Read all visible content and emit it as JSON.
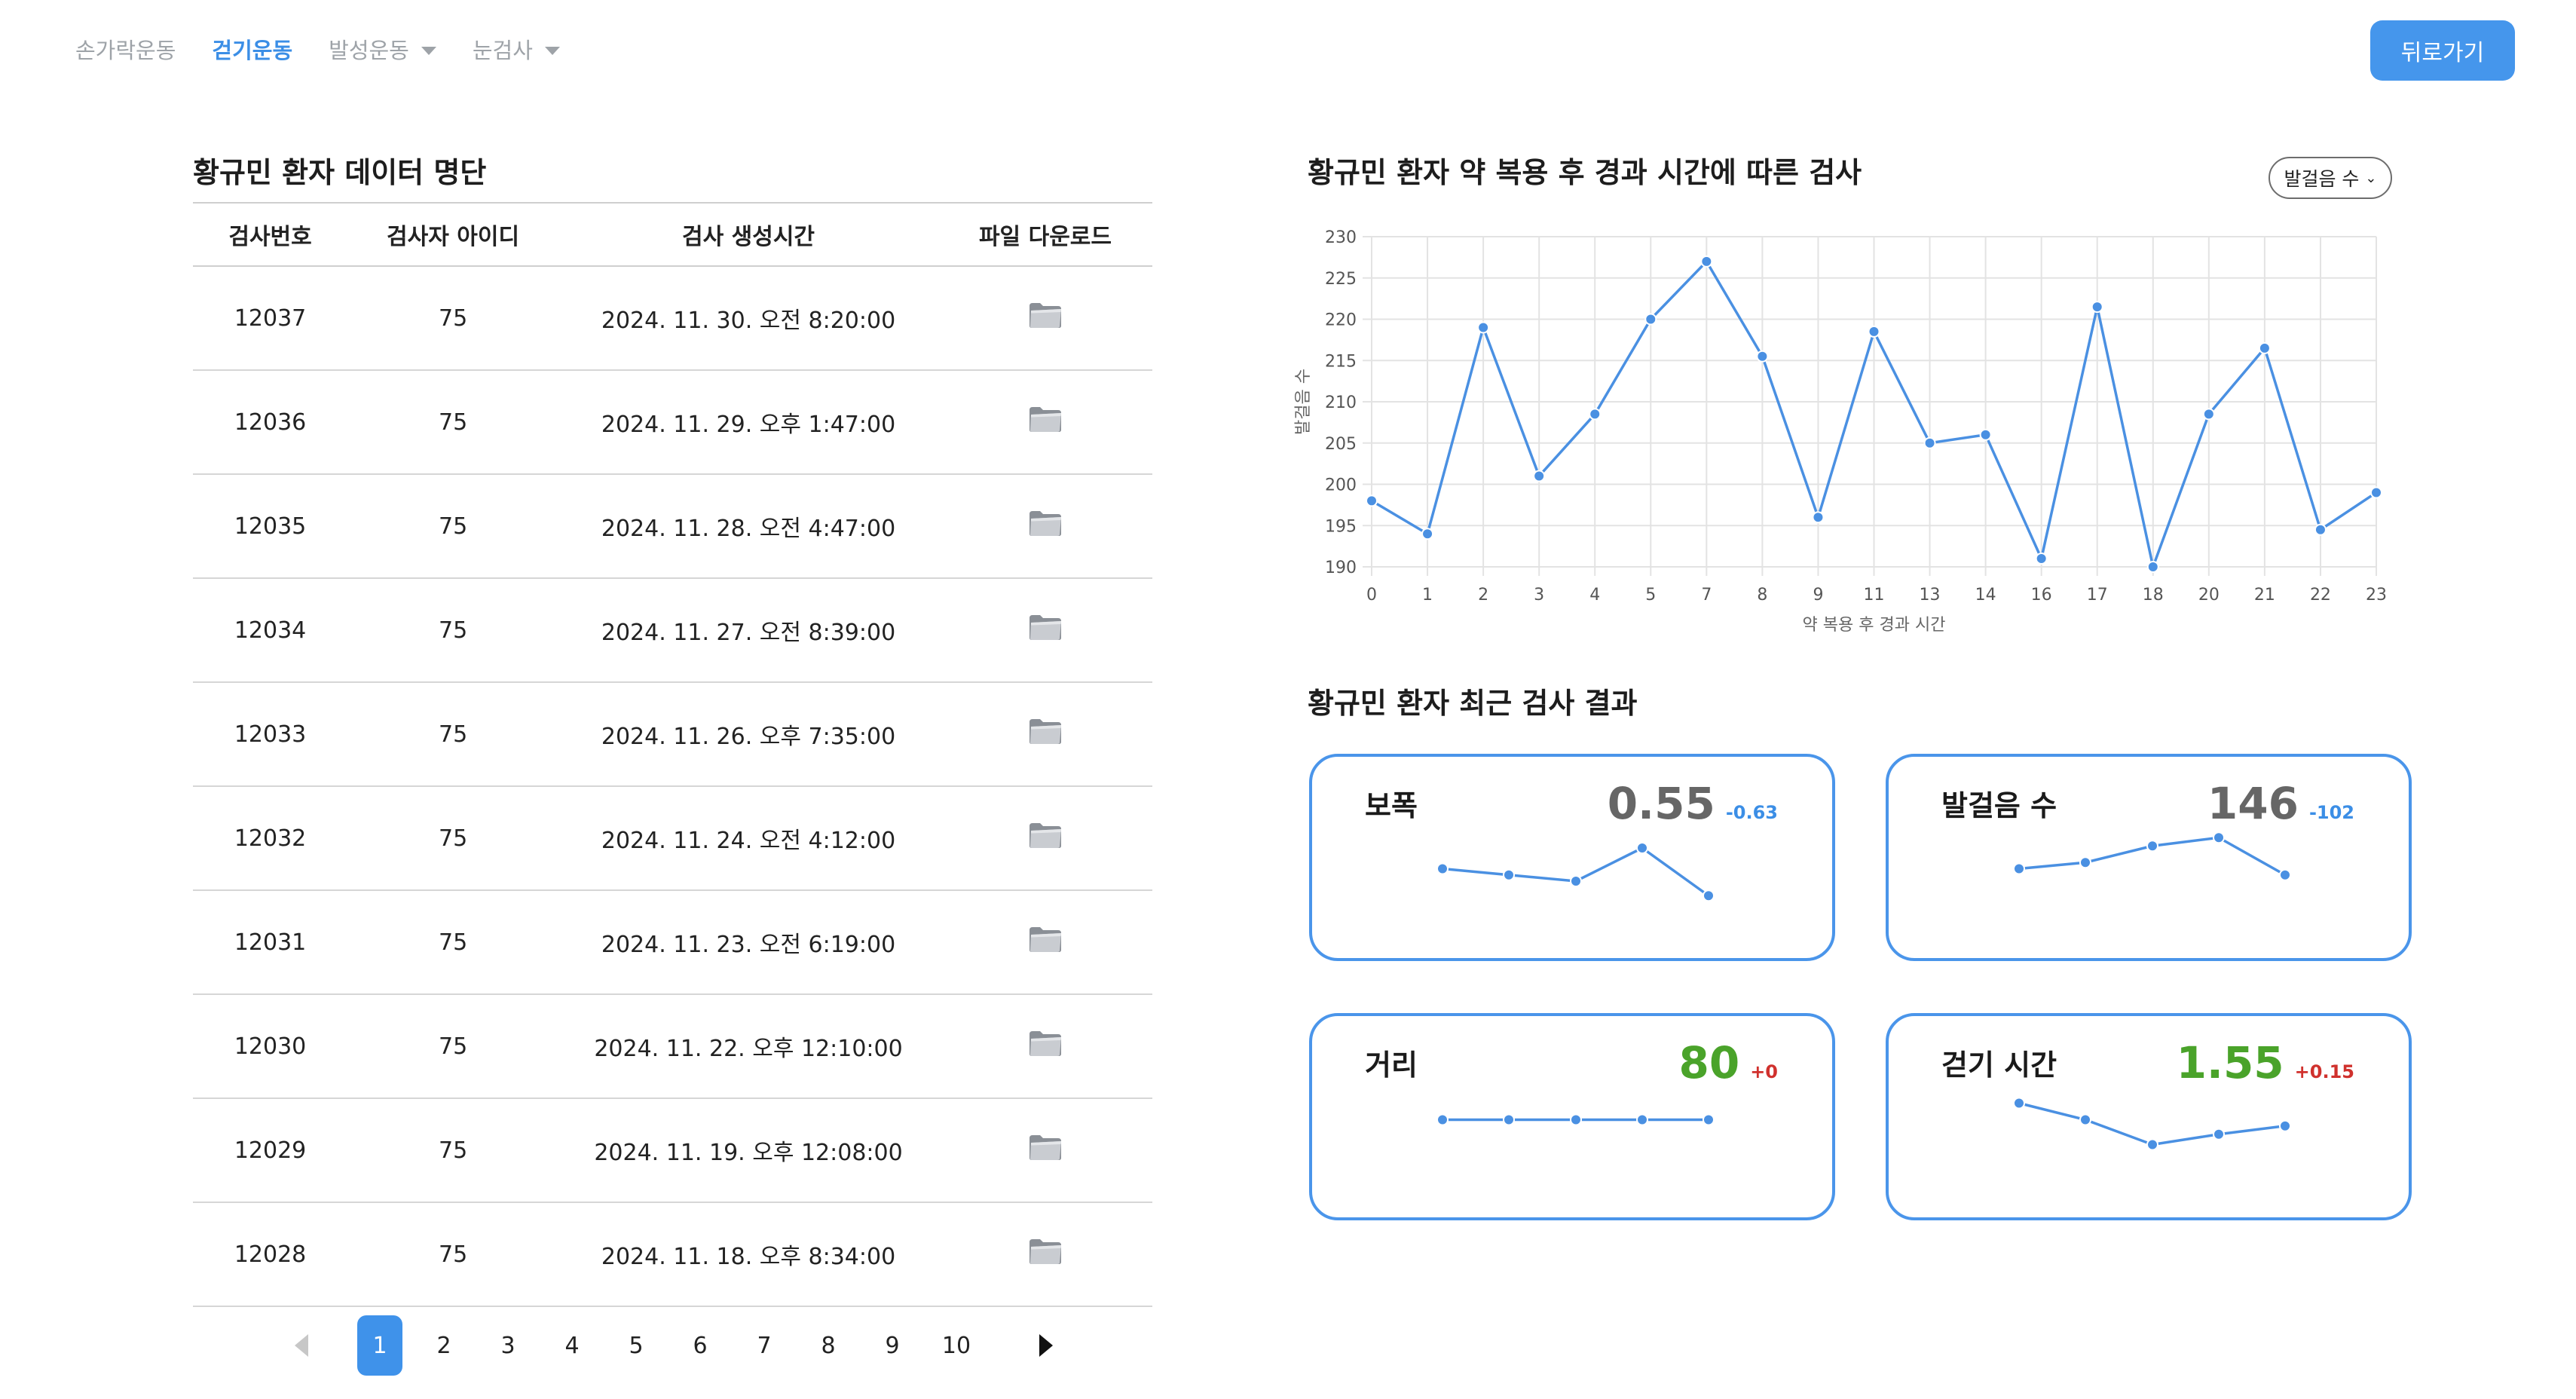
{
  "nav": {
    "items": [
      {
        "label": "손가락운동",
        "active": false,
        "dropdown": false
      },
      {
        "label": "걷기운동",
        "active": true,
        "dropdown": false
      },
      {
        "label": "발성운동",
        "active": false,
        "dropdown": true
      },
      {
        "label": "눈검사",
        "active": false,
        "dropdown": true
      }
    ],
    "back_label": "뒤로가기"
  },
  "table_section": {
    "title": "황규민 환자 데이터 명단",
    "headers": [
      "검사번호",
      "검사자 아이디",
      "검사 생성시간",
      "파일 다운로드"
    ],
    "rows": [
      {
        "id": "12037",
        "user": "75",
        "time": "2024. 11. 30. 오전 8:20:00"
      },
      {
        "id": "12036",
        "user": "75",
        "time": "2024. 11. 29. 오후 1:47:00"
      },
      {
        "id": "12035",
        "user": "75",
        "time": "2024. 11. 28. 오전 4:47:00"
      },
      {
        "id": "12034",
        "user": "75",
        "time": "2024. 11. 27. 오전 8:39:00"
      },
      {
        "id": "12033",
        "user": "75",
        "time": "2024. 11. 26. 오후 7:35:00"
      },
      {
        "id": "12032",
        "user": "75",
        "time": "2024. 11. 24. 오전 4:12:00"
      },
      {
        "id": "12031",
        "user": "75",
        "time": "2024. 11. 23. 오전 6:19:00"
      },
      {
        "id": "12030",
        "user": "75",
        "time": "2024. 11. 22. 오후 12:10:00"
      },
      {
        "id": "12029",
        "user": "75",
        "time": "2024. 11. 19. 오후 12:08:00"
      },
      {
        "id": "12028",
        "user": "75",
        "time": "2024. 11. 18. 오후 8:34:00"
      }
    ],
    "download_icon": "folder-icon"
  },
  "pagination": {
    "pages": [
      "1",
      "2",
      "3",
      "4",
      "5",
      "6",
      "7",
      "8",
      "9",
      "10"
    ],
    "current": "1"
  },
  "chart_section": {
    "title": "황규민 환자 약 복용 후 경과 시간에 따른 검사",
    "metric_select": "발걸음 수"
  },
  "chart_data": {
    "type": "line",
    "x": [
      0,
      1,
      2,
      3,
      4,
      5,
      7,
      8,
      9,
      11,
      13,
      14,
      16,
      17,
      18,
      20,
      21,
      22,
      23
    ],
    "x_ticks": [
      "0",
      "1",
      "2",
      "3",
      "4",
      "5",
      "7",
      "8",
      "9",
      "11",
      "13",
      "14",
      "16",
      "17",
      "18",
      "20",
      "21",
      "22",
      "23"
    ],
    "y": [
      198,
      194,
      219,
      201,
      208.5,
      220,
      227,
      215.5,
      196,
      218.5,
      205,
      206,
      191,
      221.5,
      190,
      208.5,
      216.5,
      194.5,
      199
    ],
    "y_ticks": [
      "190",
      "195",
      "200",
      "205",
      "210",
      "215",
      "220",
      "225",
      "230"
    ],
    "ylim": [
      190,
      230
    ],
    "xlabel": "약 복용 후 경과 시간",
    "ylabel": "발걸음 수",
    "grid": true,
    "color": "#4a90e2"
  },
  "results_section": {
    "title": "황규민 환자 최근 검사 결과",
    "cards": [
      {
        "label": "보폭",
        "value": "0.55",
        "delta": "-0.63",
        "value_color": "#666666",
        "delta_color": "#3b8ee6",
        "trend": [
          0.46,
          0.43,
          0.4,
          0.56,
          0.33
        ]
      },
      {
        "label": "발걸음 수",
        "value": "146",
        "delta": "-102",
        "value_color": "#666666",
        "delta_color": "#3b8ee6",
        "trend": [
          0.46,
          0.49,
          0.57,
          0.61,
          0.43
        ]
      },
      {
        "label": "거리",
        "value": "80",
        "delta": "+0",
        "value_color": "#4aa32a",
        "delta_color": "#d0312d",
        "trend": [
          0.5,
          0.5,
          0.5,
          0.5,
          0.5
        ]
      },
      {
        "label": "걷기 시간",
        "value": "1.55",
        "delta": "+0.15",
        "value_color": "#4aa32a",
        "delta_color": "#d0312d",
        "trend": [
          0.58,
          0.5,
          0.38,
          0.43,
          0.47
        ]
      }
    ]
  }
}
